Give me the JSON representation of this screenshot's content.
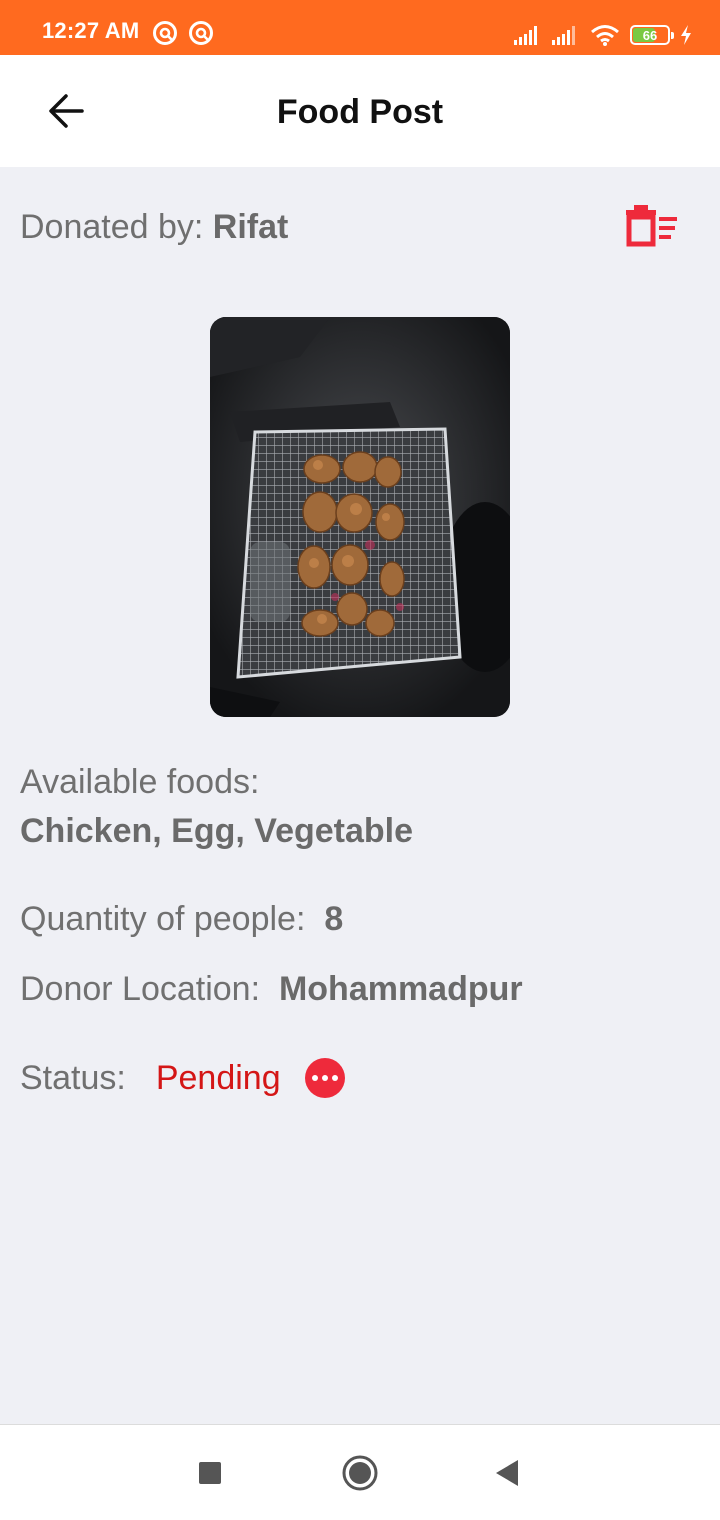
{
  "status_bar": {
    "time": "12:27 AM",
    "battery_level": "66",
    "battery_percent": 66,
    "icons": [
      "notification-icon",
      "notification-icon",
      "signal-icon",
      "signal-icon",
      "wifi-icon",
      "battery-icon",
      "charging-icon"
    ]
  },
  "app_bar": {
    "title": "Food Post",
    "back_icon": "arrow-left-icon"
  },
  "post": {
    "donated_label": "Donated by: ",
    "donor_name": "Rifat",
    "delete_icon": "delete-list-icon",
    "foods_label": "Available foods:",
    "foods_value": "Chicken, Egg, Vegetable",
    "quantity_label": "Quantity of people:",
    "quantity_value": "8",
    "location_label": "Donor Location:",
    "location_value": "Mohammadpur",
    "status_label": "Status:",
    "status_value": "Pending",
    "status_icon": "more-horizontal-icon"
  },
  "nav_bar": {
    "buttons": [
      "recents-square-icon",
      "home-circle-icon",
      "back-triangle-icon"
    ]
  },
  "colors": {
    "status_bar": "#ff6a1f",
    "background": "#eff0f5",
    "accent_red": "#ee2a3b",
    "status_pending": "#d41616"
  }
}
